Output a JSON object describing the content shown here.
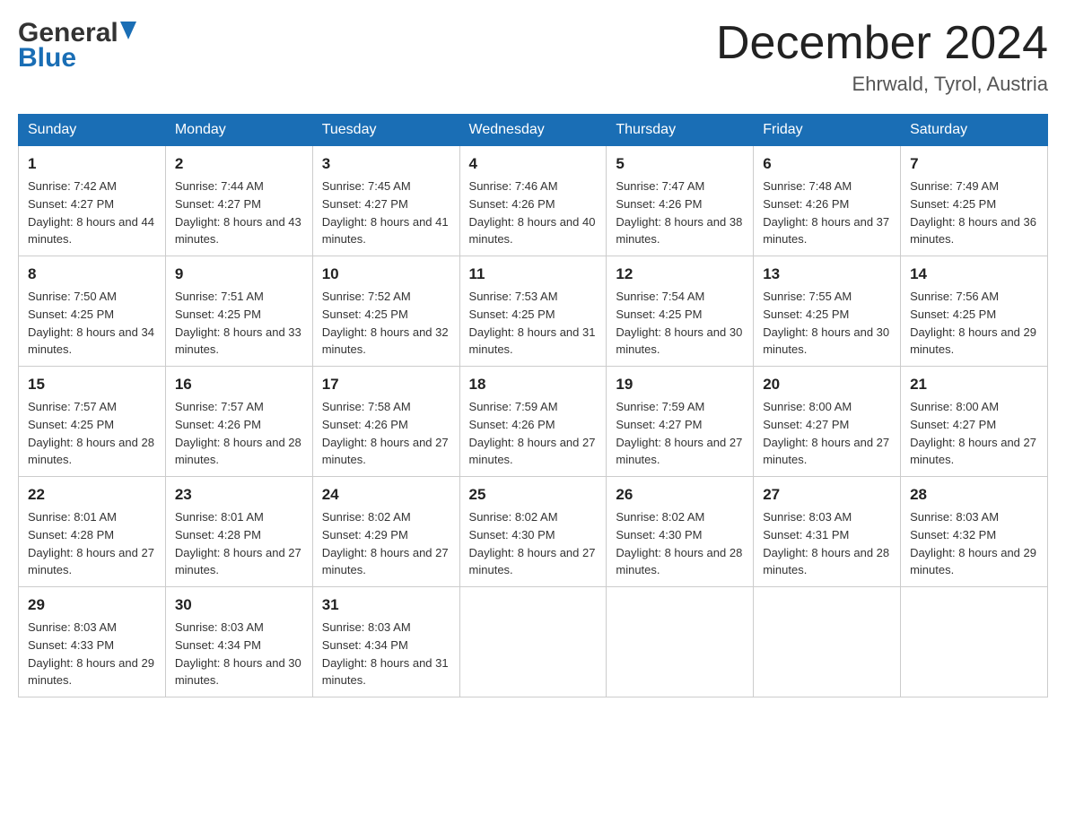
{
  "header": {
    "logo_general": "General",
    "logo_blue": "Blue",
    "month_title": "December 2024",
    "subtitle": "Ehrwald, Tyrol, Austria"
  },
  "days_of_week": [
    "Sunday",
    "Monday",
    "Tuesday",
    "Wednesday",
    "Thursday",
    "Friday",
    "Saturday"
  ],
  "weeks": [
    [
      {
        "day": "1",
        "sunrise": "7:42 AM",
        "sunset": "4:27 PM",
        "daylight": "8 hours and 44 minutes."
      },
      {
        "day": "2",
        "sunrise": "7:44 AM",
        "sunset": "4:27 PM",
        "daylight": "8 hours and 43 minutes."
      },
      {
        "day": "3",
        "sunrise": "7:45 AM",
        "sunset": "4:27 PM",
        "daylight": "8 hours and 41 minutes."
      },
      {
        "day": "4",
        "sunrise": "7:46 AM",
        "sunset": "4:26 PM",
        "daylight": "8 hours and 40 minutes."
      },
      {
        "day": "5",
        "sunrise": "7:47 AM",
        "sunset": "4:26 PM",
        "daylight": "8 hours and 38 minutes."
      },
      {
        "day": "6",
        "sunrise": "7:48 AM",
        "sunset": "4:26 PM",
        "daylight": "8 hours and 37 minutes."
      },
      {
        "day": "7",
        "sunrise": "7:49 AM",
        "sunset": "4:25 PM",
        "daylight": "8 hours and 36 minutes."
      }
    ],
    [
      {
        "day": "8",
        "sunrise": "7:50 AM",
        "sunset": "4:25 PM",
        "daylight": "8 hours and 34 minutes."
      },
      {
        "day": "9",
        "sunrise": "7:51 AM",
        "sunset": "4:25 PM",
        "daylight": "8 hours and 33 minutes."
      },
      {
        "day": "10",
        "sunrise": "7:52 AM",
        "sunset": "4:25 PM",
        "daylight": "8 hours and 32 minutes."
      },
      {
        "day": "11",
        "sunrise": "7:53 AM",
        "sunset": "4:25 PM",
        "daylight": "8 hours and 31 minutes."
      },
      {
        "day": "12",
        "sunrise": "7:54 AM",
        "sunset": "4:25 PM",
        "daylight": "8 hours and 30 minutes."
      },
      {
        "day": "13",
        "sunrise": "7:55 AM",
        "sunset": "4:25 PM",
        "daylight": "8 hours and 30 minutes."
      },
      {
        "day": "14",
        "sunrise": "7:56 AM",
        "sunset": "4:25 PM",
        "daylight": "8 hours and 29 minutes."
      }
    ],
    [
      {
        "day": "15",
        "sunrise": "7:57 AM",
        "sunset": "4:25 PM",
        "daylight": "8 hours and 28 minutes."
      },
      {
        "day": "16",
        "sunrise": "7:57 AM",
        "sunset": "4:26 PM",
        "daylight": "8 hours and 28 minutes."
      },
      {
        "day": "17",
        "sunrise": "7:58 AM",
        "sunset": "4:26 PM",
        "daylight": "8 hours and 27 minutes."
      },
      {
        "day": "18",
        "sunrise": "7:59 AM",
        "sunset": "4:26 PM",
        "daylight": "8 hours and 27 minutes."
      },
      {
        "day": "19",
        "sunrise": "7:59 AM",
        "sunset": "4:27 PM",
        "daylight": "8 hours and 27 minutes."
      },
      {
        "day": "20",
        "sunrise": "8:00 AM",
        "sunset": "4:27 PM",
        "daylight": "8 hours and 27 minutes."
      },
      {
        "day": "21",
        "sunrise": "8:00 AM",
        "sunset": "4:27 PM",
        "daylight": "8 hours and 27 minutes."
      }
    ],
    [
      {
        "day": "22",
        "sunrise": "8:01 AM",
        "sunset": "4:28 PM",
        "daylight": "8 hours and 27 minutes."
      },
      {
        "day": "23",
        "sunrise": "8:01 AM",
        "sunset": "4:28 PM",
        "daylight": "8 hours and 27 minutes."
      },
      {
        "day": "24",
        "sunrise": "8:02 AM",
        "sunset": "4:29 PM",
        "daylight": "8 hours and 27 minutes."
      },
      {
        "day": "25",
        "sunrise": "8:02 AM",
        "sunset": "4:30 PM",
        "daylight": "8 hours and 27 minutes."
      },
      {
        "day": "26",
        "sunrise": "8:02 AM",
        "sunset": "4:30 PM",
        "daylight": "8 hours and 28 minutes."
      },
      {
        "day": "27",
        "sunrise": "8:03 AM",
        "sunset": "4:31 PM",
        "daylight": "8 hours and 28 minutes."
      },
      {
        "day": "28",
        "sunrise": "8:03 AM",
        "sunset": "4:32 PM",
        "daylight": "8 hours and 29 minutes."
      }
    ],
    [
      {
        "day": "29",
        "sunrise": "8:03 AM",
        "sunset": "4:33 PM",
        "daylight": "8 hours and 29 minutes."
      },
      {
        "day": "30",
        "sunrise": "8:03 AM",
        "sunset": "4:34 PM",
        "daylight": "8 hours and 30 minutes."
      },
      {
        "day": "31",
        "sunrise": "8:03 AM",
        "sunset": "4:34 PM",
        "daylight": "8 hours and 31 minutes."
      },
      null,
      null,
      null,
      null
    ]
  ],
  "labels": {
    "sunrise": "Sunrise: ",
    "sunset": "Sunset: ",
    "daylight": "Daylight: "
  }
}
